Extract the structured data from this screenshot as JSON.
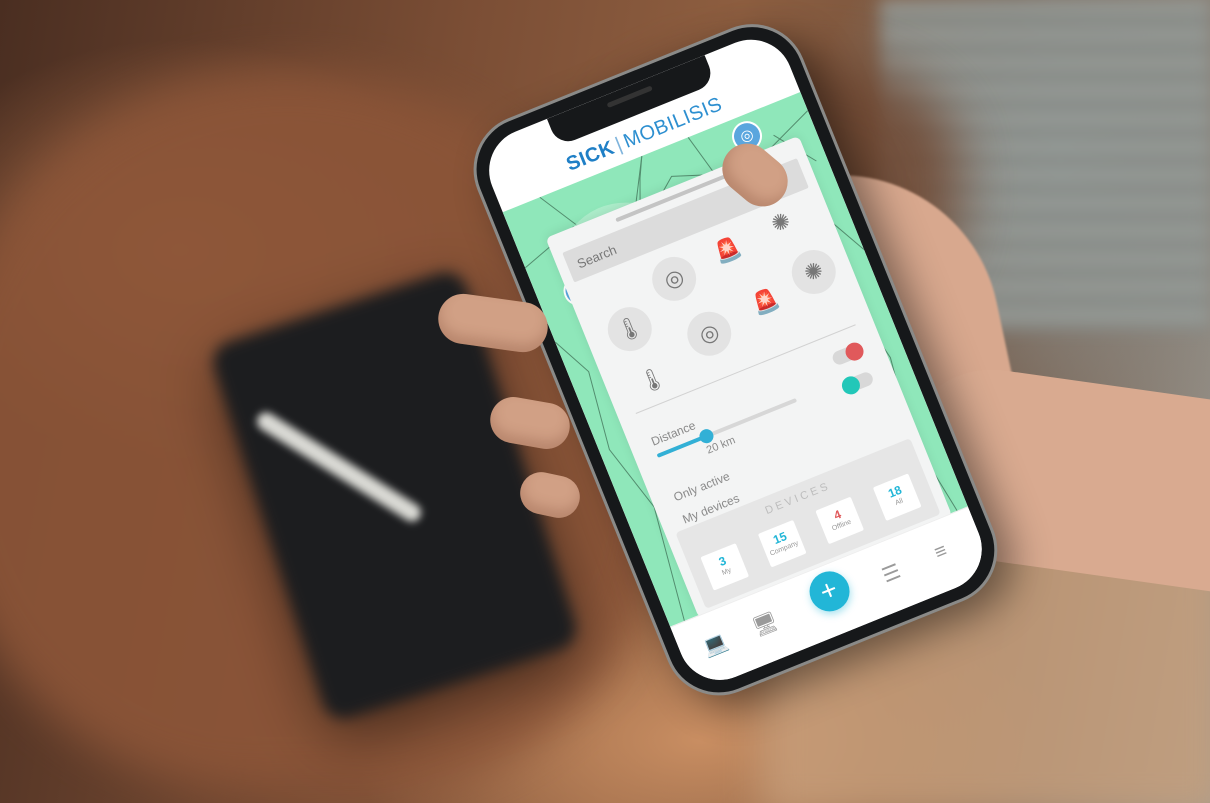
{
  "app": {
    "brand_left": "SICK",
    "brand_right": "MOBILISIS"
  },
  "search": {
    "placeholder": "Search"
  },
  "sensor_icons": [
    {
      "name": "thermometer-icon"
    },
    {
      "name": "radar-icon"
    },
    {
      "name": "alarm-light-icon"
    },
    {
      "name": "virus-icon"
    }
  ],
  "filters": {
    "distance_label": "Distance",
    "distance_value": "20 km",
    "distance_fraction": 0.35,
    "only_active_label": "Only active",
    "my_devices_label": "My devices"
  },
  "devices": {
    "title": "DEVICES",
    "counts": [
      {
        "value": "3",
        "label": "My",
        "color": "#22b6d7"
      },
      {
        "value": "15",
        "label": "Company",
        "color": "#22b6d7"
      },
      {
        "value": "4",
        "label": "Offline",
        "color": "#e0595b"
      },
      {
        "value": "18",
        "label": "All",
        "color": "#22b6d7"
      }
    ]
  },
  "colors": {
    "accent": "#22b6d7",
    "map": "#8fe7ba",
    "toggle_red": "#e0595b",
    "toggle_teal": "#22c7b8"
  }
}
